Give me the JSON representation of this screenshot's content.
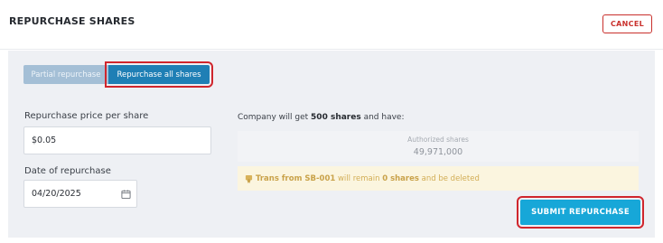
{
  "header": {
    "title": "REPURCHASE SHARES",
    "cancel_label": "CANCEL"
  },
  "tabs": [
    {
      "label": "Partial repurchase",
      "active": false
    },
    {
      "label": "Repurchase all shares",
      "active": true
    }
  ],
  "form": {
    "price_label": "Repurchase price per share",
    "price_value": "$0.05",
    "date_label": "Date of repurchase",
    "date_value": "04/20/2025",
    "date_icon": "calendar-icon"
  },
  "summary": {
    "prefix": "Company will get ",
    "shares": "500 shares",
    "suffix": " and have:"
  },
  "authorized": {
    "label": "Authorized shares",
    "value": "49,971,000"
  },
  "notice": {
    "icon": "certificate-icon",
    "part1": "Trans from SB-001",
    "part2": " will remain ",
    "part3": "0 shares",
    "part4": " and be deleted"
  },
  "submit_label": "SUBMIT REPURCHASE",
  "colors": {
    "accent": "#17a7d8",
    "active_tab": "#1f7fb5",
    "inactive_tab": "#a4bfd6",
    "danger": "#c9302c",
    "highlight_outline": "#d0262d",
    "notice_bg": "#fbf5df"
  }
}
